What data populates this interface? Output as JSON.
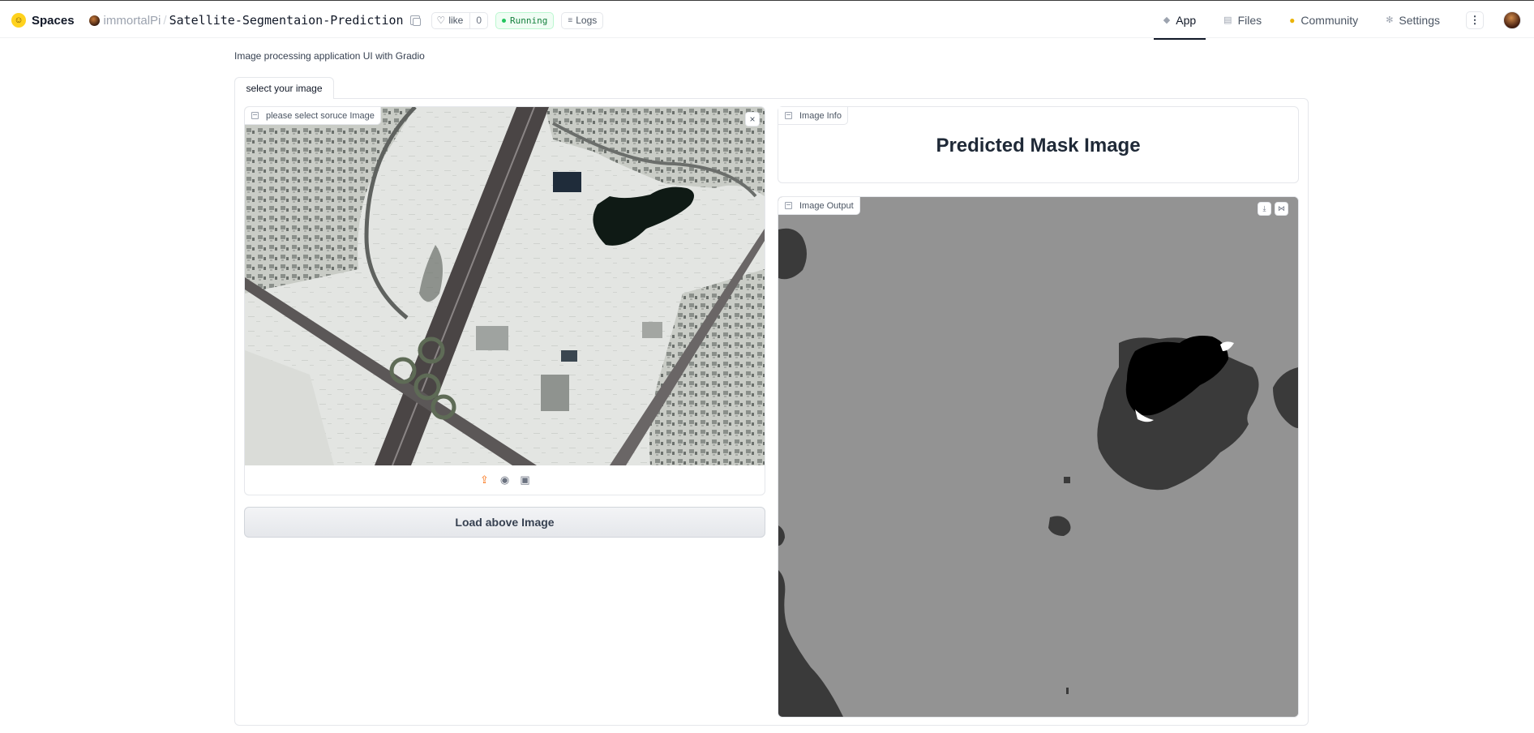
{
  "header": {
    "brand": "Spaces",
    "owner": "immortalPi",
    "separator": "/",
    "repo": "Satellite-Segmentaion-Prediction",
    "like_label": "like",
    "like_count": "0",
    "status": "Running",
    "logs_label": "Logs",
    "nav": [
      {
        "label": "App",
        "icon": "cube-icon"
      },
      {
        "label": "Files",
        "icon": "files-icon"
      },
      {
        "label": "Community",
        "icon": "community-icon"
      },
      {
        "label": "Settings",
        "icon": "gear-icon"
      }
    ],
    "more_label": "⋮"
  },
  "app": {
    "description": "Image processing application UI with Gradio",
    "tab_label": "select your image",
    "input_image": {
      "label": "please select soruce Image",
      "clear_label": "×"
    },
    "load_button": "Load above Image",
    "info": {
      "label": "Image Info",
      "title": "Predicted Mask Image"
    },
    "output_image": {
      "label": "Image Output"
    }
  },
  "colors": {
    "running_green": "#22c55e",
    "upload_orange": "#f97316",
    "mask_background": "#939393",
    "mask_water": "#000000",
    "mask_dark": "#3a3a3a"
  }
}
